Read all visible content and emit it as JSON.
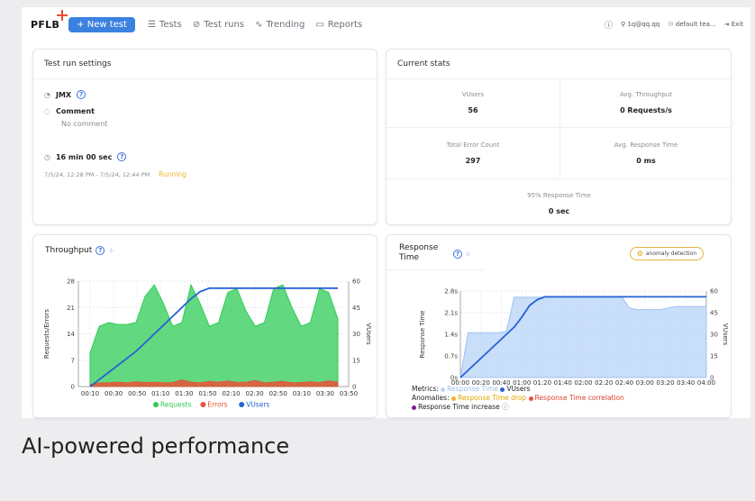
{
  "nav": {
    "logo": "PFLB",
    "new_test": "+ New test",
    "tests": "Tests",
    "test_runs": "Test runs",
    "trending": "Trending",
    "reports": "Reports",
    "user": "1q@qq.qq",
    "team": "default tea...",
    "exit": "Exit"
  },
  "settings": {
    "title": "Test run settings",
    "type": "JMX",
    "comment_label": "Comment",
    "comment_value": "No comment",
    "duration": "16 min 00 sec",
    "period": "7/5/24, 12:28 PM - 7/5/24, 12:44 PM",
    "status": "Running",
    "status_color": "#f0b429"
  },
  "stats": {
    "title": "Current stats",
    "vusers_label": "VUsers",
    "vusers": "56",
    "throughput_label": "Avg. Throughput",
    "throughput": "0 Requests/s",
    "errors_label": "Total Error Count",
    "errors": "297",
    "response_label": "Avg. Response Time",
    "response": "0 ms",
    "p95_label": "95% Response Time",
    "p95": "0 sec"
  },
  "throughput_panel": {
    "title": "Throughput"
  },
  "response_panel": {
    "title_line1": "Response",
    "title_line2": "Time",
    "anomaly_button": "anomaly detection",
    "metrics_label": "Metrics:",
    "anomalies_label": "Anomalies:",
    "anomaly_drop": "Response Time drop",
    "anomaly_correlation": "Response Time correlation",
    "anomaly_increase": "Response Time increase"
  },
  "chart_data": [
    {
      "type": "area",
      "ylabel": "Requests/Errors",
      "y2label": "VUsers",
      "ylim": [
        0,
        28
      ],
      "y2lim": [
        0,
        60
      ],
      "yticks": [
        0,
        7,
        14,
        21,
        28
      ],
      "y2ticks": [
        0,
        15,
        30,
        45,
        60
      ],
      "xticks": [
        "00:10",
        "00:30",
        "00:50",
        "01:10",
        "01:30",
        "01:50",
        "02:10",
        "02:30",
        "02:50",
        "03:10",
        "03:30",
        "03:50"
      ],
      "legend_position": "bottom",
      "series": [
        {
          "name": "Requests",
          "color": "#2ecc55",
          "values": [
            9,
            16,
            17,
            16.5,
            16.5,
            17,
            24,
            27,
            22,
            16,
            17,
            27,
            22,
            16,
            17,
            25,
            26,
            20,
            16,
            17,
            26,
            27,
            21,
            16,
            17,
            26,
            25,
            18
          ]
        },
        {
          "name": "Errors",
          "color": "#e8523a",
          "values": [
            0.5,
            1.0,
            1.0,
            1.2,
            1.0,
            1.3,
            1.1,
            1.2,
            1.0,
            1.1,
            1.8,
            1.2,
            1.0,
            1.4,
            1.2,
            1.5,
            1.1,
            1.2,
            1.6,
            1.0,
            1.2,
            1.4,
            1.0,
            1.1,
            1.3,
            1.1,
            1.5,
            1.2
          ]
        },
        {
          "name": "VUsers",
          "color": "#2562d4",
          "values": [
            0,
            4,
            8,
            12,
            16,
            20,
            25,
            30,
            35,
            40,
            45,
            50,
            54,
            56,
            56,
            56,
            56,
            56,
            56,
            56,
            56,
            56,
            56,
            56,
            56,
            56,
            56,
            56
          ]
        }
      ]
    },
    {
      "type": "area",
      "ylabel": "Response Time",
      "y2label": "VUsers",
      "ylim": [
        0,
        2.8
      ],
      "y2lim": [
        0,
        60
      ],
      "ytick_labels": [
        "0s",
        "0.7s",
        "1.4s",
        "2.1s",
        "2.8s"
      ],
      "yticks": [
        0,
        0.7,
        1.4,
        2.1,
        2.8
      ],
      "y2ticks": [
        0,
        15,
        30,
        45,
        60
      ],
      "xticks": [
        "00:00",
        "00:20",
        "00:40",
        "01:00",
        "01:20",
        "01:40",
        "02:00",
        "02:20",
        "02:40",
        "03:00",
        "03:20",
        "03:40",
        "04:00"
      ],
      "series": [
        {
          "name": "Response Time",
          "color": "#bcd6f8",
          "values": [
            0,
            1.45,
            1.45,
            1.45,
            1.45,
            1.45,
            1.5,
            2.6,
            2.6,
            2.6,
            2.6,
            2.6,
            2.6,
            2.6,
            2.6,
            2.6,
            2.6,
            2.6,
            2.6,
            2.6,
            2.6,
            2.6,
            2.25,
            2.2,
            2.2,
            2.2,
            2.2,
            2.25,
            2.3,
            2.3,
            2.3,
            2.3,
            2.3
          ]
        },
        {
          "name": "VUsers",
          "color": "#2562d4",
          "values": [
            0,
            5,
            10,
            15,
            20,
            25,
            30,
            35,
            42,
            50,
            54,
            56,
            56,
            56,
            56,
            56,
            56,
            56,
            56,
            56,
            56,
            56,
            56,
            56,
            56,
            56,
            56,
            56,
            56,
            56,
            56,
            56,
            56
          ]
        }
      ],
      "anomaly_colors": {
        "drop": "#f0b429",
        "correlation": "#e8523a",
        "increase": "#7b1f8f"
      }
    }
  ],
  "footer": {
    "text": "AI-powered performance"
  }
}
